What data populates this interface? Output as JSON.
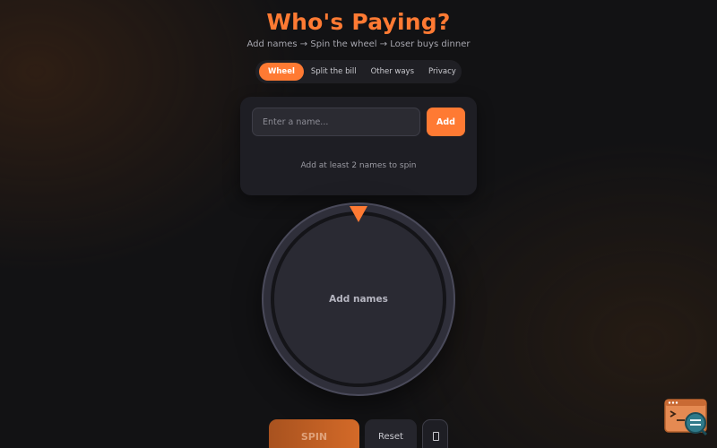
{
  "header": {
    "title": "Who's Paying?",
    "subtitle": "Add names → Spin the wheel → Loser buys dinner"
  },
  "tabs": [
    {
      "label": "Wheel",
      "active": true
    },
    {
      "label": "Split the bill",
      "active": false
    },
    {
      "label": "Other ways",
      "active": false
    },
    {
      "label": "Privacy",
      "active": false
    }
  ],
  "entry": {
    "placeholder": "Enter a name...",
    "value": "",
    "add_label": "Add",
    "hint": "Add at least 2 names to spin"
  },
  "wheel": {
    "center_label": "Add names"
  },
  "controls": {
    "spin_label": "SPIN",
    "reset_label": "Reset",
    "sound_icon": "sound-toggle-icon"
  },
  "corner_widget": {
    "icon": "feedback-window-icon"
  },
  "colors": {
    "accent": "#ff7a33",
    "background": "#121214",
    "card": "#1e1e24",
    "wheel": "#2a2a33"
  }
}
